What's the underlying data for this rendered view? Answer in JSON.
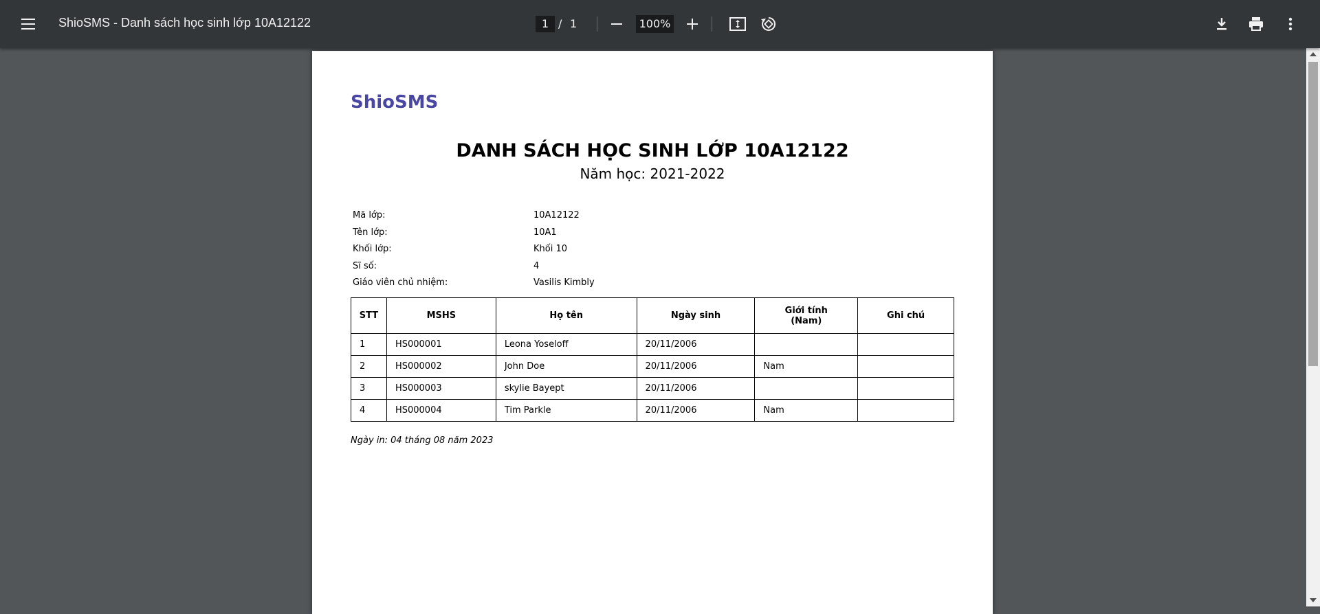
{
  "toolbar": {
    "title": "ShioSMS - Danh sách học sinh lớp 10A12122",
    "page_current": "1",
    "page_separator": "/",
    "page_total": "1",
    "zoom": "100%",
    "icons": [
      "menu-icon",
      "zoom-out-icon",
      "zoom-in-icon",
      "fit-page-icon",
      "rotate-icon",
      "download-icon",
      "print-icon",
      "more-vert-icon"
    ]
  },
  "document": {
    "brand": "ShioSMS",
    "title": "DANH SÁCH HỌC SINH LỚP 10A12122",
    "year_line": "Năm học: 2021-2022",
    "info": [
      {
        "label": "Mã lớp:",
        "value": "10A12122"
      },
      {
        "label": "Tên lớp:",
        "value": "10A1"
      },
      {
        "label": "Khối lớp:",
        "value": "Khối 10"
      },
      {
        "label": "Sĩ số:",
        "value": "4"
      },
      {
        "label": "Giáo viên chủ nhiệm:",
        "value": "Vasilis Kimbly"
      }
    ],
    "table": {
      "headers": [
        "STT",
        "MSHS",
        "Họ tên",
        "Ngày sinh",
        "Giới tính\n(Nam)",
        "Ghi chú"
      ],
      "rows": [
        [
          "1",
          "HS000001",
          "Leona Yoseloff",
          "20/11/2006",
          "",
          ""
        ],
        [
          "2",
          "HS000002",
          "John Doe",
          "20/11/2006",
          "Nam",
          ""
        ],
        [
          "3",
          "HS000003",
          "skylie Bayept",
          "20/11/2006",
          "",
          ""
        ],
        [
          "4",
          "HS000004",
          "Tim Parkle",
          "20/11/2006",
          "Nam",
          ""
        ]
      ]
    },
    "print_date": "Ngày in: 04 tháng 08 năm 2023"
  },
  "colors": {
    "toolbar_bg": "#323639",
    "viewer_bg": "#525659",
    "brand": "#4a47a3"
  }
}
